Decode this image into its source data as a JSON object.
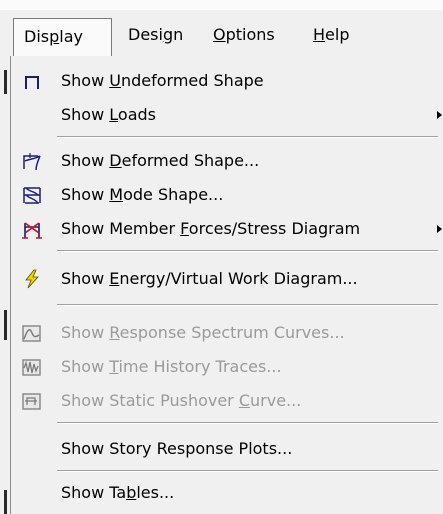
{
  "menubar": {
    "items": [
      {
        "pre": "Dis",
        "key": "p",
        "post": "lay"
      },
      {
        "pre": "Desi",
        "key": "g",
        "post": "n"
      },
      {
        "pre": "",
        "key": "O",
        "post": "ptions"
      },
      {
        "pre": "",
        "key": "H",
        "post": "elp"
      }
    ]
  },
  "menu": {
    "items": [
      {
        "pre": "Show ",
        "key": "U",
        "post": "ndeformed Shape",
        "icon": "undeformed-frame-icon"
      },
      {
        "pre": "Show ",
        "key": "L",
        "post": "oads",
        "submenu": true
      },
      {
        "pre": "Show  ",
        "key": "D",
        "post": "eformed Shape...",
        "icon": "deformed-shape-icon"
      },
      {
        "pre": "Show  ",
        "key": "M",
        "post": "ode Shape...",
        "icon": "mode-shape-icon"
      },
      {
        "pre": "Show Member ",
        "key": "F",
        "post": "orces/Stress Diagram",
        "icon": "member-forces-icon",
        "submenu": true
      },
      {
        "pre": "Show ",
        "key": "E",
        "post": "nergy/Virtual Work Diagram...",
        "icon": "lightning-icon"
      },
      {
        "pre": "Show ",
        "key": "R",
        "post": "esponse Spectrum Curves...",
        "icon": "response-spectrum-icon",
        "disabled": true
      },
      {
        "pre": "Show ",
        "key": "T",
        "post": "ime History Traces...",
        "icon": "time-history-icon",
        "disabled": true
      },
      {
        "pre": "Show Static Pushover ",
        "key": "C",
        "post": "urve...",
        "icon": "pushover-curve-icon",
        "disabled": true
      },
      {
        "pre": "Show Story Response Plots...",
        "key": "",
        "post": ""
      },
      {
        "pre": "Show Ta",
        "key": "b",
        "post": "les..."
      }
    ]
  }
}
